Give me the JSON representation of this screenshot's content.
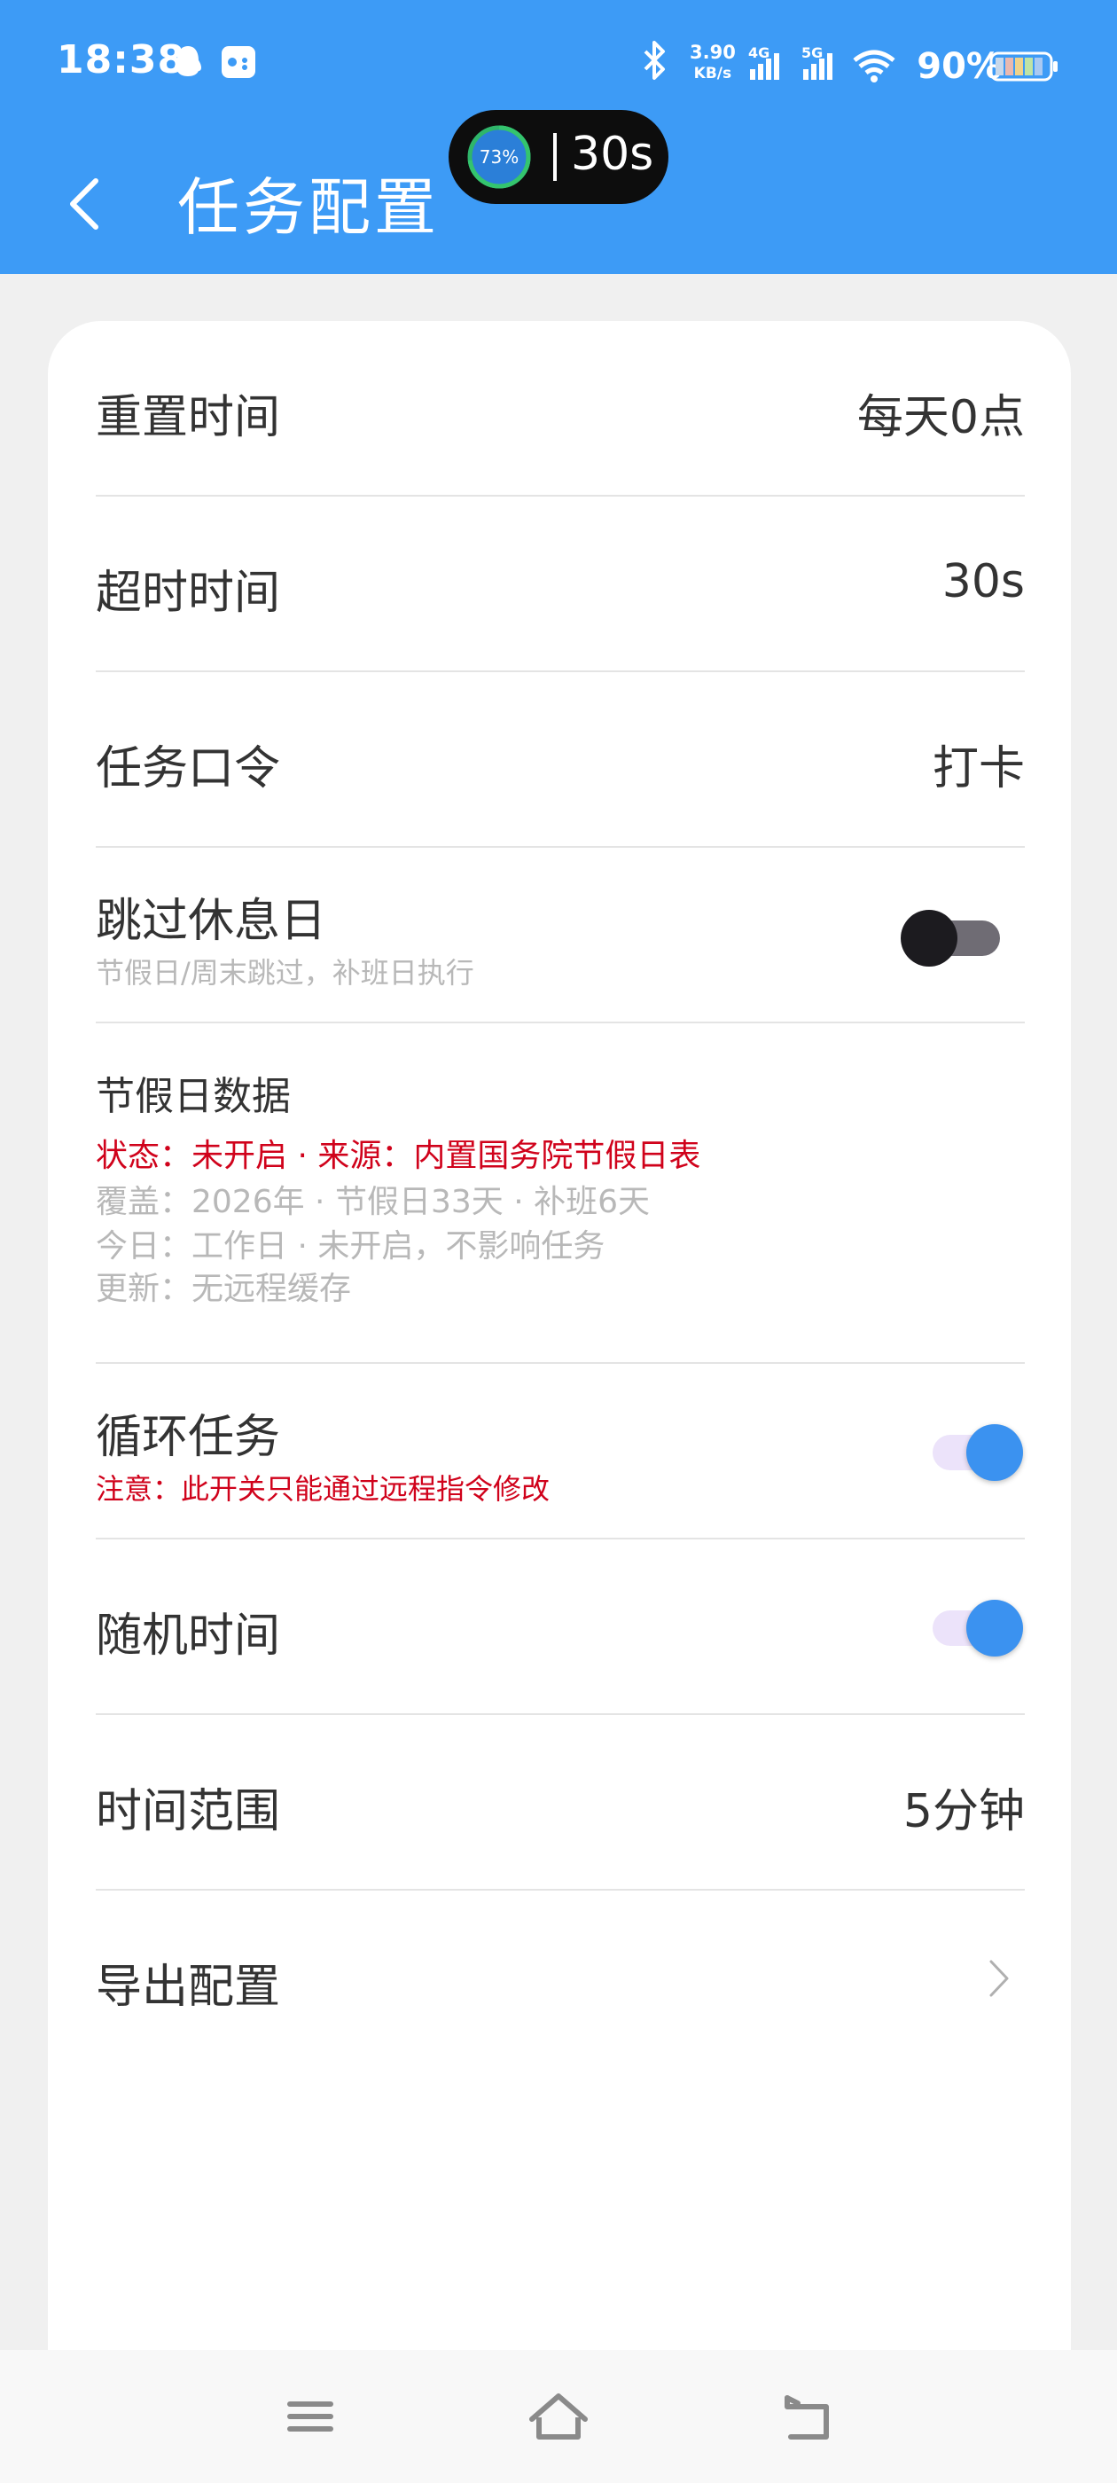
{
  "status_bar": {
    "time": "18:38",
    "net_speed_value": "3.90",
    "net_speed_unit": "KB/s",
    "net_4g": "4G",
    "net_5g": "5G",
    "battery": "90%",
    "icons": [
      "qq-icon",
      "game-icon",
      "bluetooth-icon",
      "signal-4g-icon",
      "signal-5g-icon",
      "wifi-icon",
      "battery-icon"
    ]
  },
  "header": {
    "title": "任务配置",
    "back_icon": "chevron-left-icon"
  },
  "overlay_pill": {
    "percent_text": "73%",
    "percent_value": 0.73,
    "countdown": "30s"
  },
  "settings": {
    "reset_time": {
      "label": "重置时间",
      "value": "每天0点"
    },
    "timeout": {
      "label": "超时时间",
      "value": "30s"
    },
    "command": {
      "label": "任务口令",
      "value": "打卡"
    },
    "skip_rest_day": {
      "label": "跳过休息日",
      "hint": "节假日/周末跳过，补班日执行",
      "enabled": false
    },
    "holiday_data": {
      "label": "节假日数据",
      "status": "状态：未开启 · 来源：内置国务院节假日表",
      "coverage": "覆盖：2026年 · 节假日33天 · 补班6天",
      "today": "今日：工作日 · 未开启，不影响任务",
      "update": "更新：无远程缓存"
    },
    "loop_task": {
      "label": "循环任务",
      "note": "注意：此开关只能通过远程指令修改",
      "enabled": true
    },
    "random_time": {
      "label": "随机时间",
      "enabled": true
    },
    "time_range": {
      "label": "时间范围",
      "value": "5分钟"
    },
    "export": {
      "label": "导出配置",
      "icon": "chevron-right-icon"
    }
  },
  "colors": {
    "primary": "#3d9bf6",
    "toggle_on": "#3b92f0",
    "warning_red": "#d0021b"
  },
  "nav_bar": {
    "icons": [
      "menu-icon",
      "home-icon",
      "back-icon"
    ]
  }
}
